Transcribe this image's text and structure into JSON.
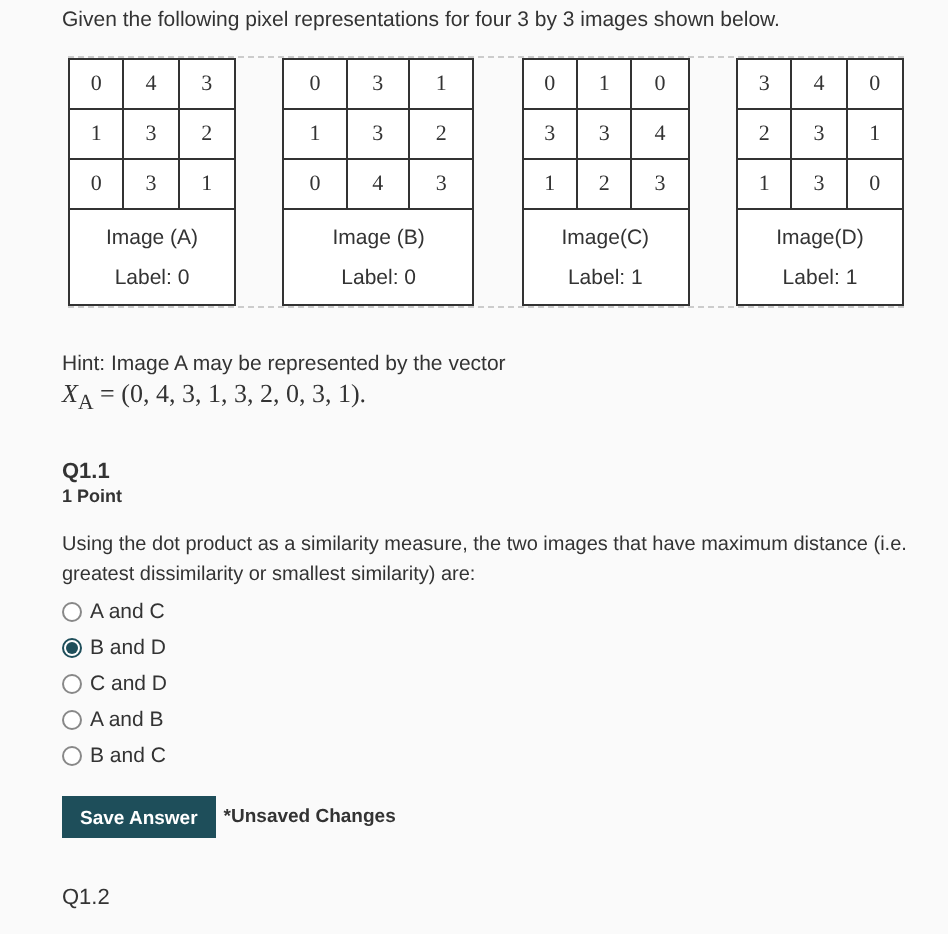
{
  "intro": "Given the following pixel representations for four 3 by 3 images shown below.",
  "images": [
    {
      "rows": [
        [
          "0",
          "4",
          "3"
        ],
        [
          "1",
          "3",
          "2"
        ],
        [
          "0",
          "3",
          "1"
        ]
      ],
      "name": "Image (A)",
      "label": "Label: 0"
    },
    {
      "rows": [
        [
          "0",
          "3",
          "1"
        ],
        [
          "1",
          "3",
          "2"
        ],
        [
          "0",
          "4",
          "3"
        ]
      ],
      "name": "Image (B)",
      "label": "Label: 0"
    },
    {
      "rows": [
        [
          "0",
          "1",
          "0"
        ],
        [
          "3",
          "3",
          "4"
        ],
        [
          "1",
          "2",
          "3"
        ]
      ],
      "name": "Image(C)",
      "label": "Label: 1"
    },
    {
      "rows": [
        [
          "3",
          "4",
          "0"
        ],
        [
          "2",
          "3",
          "1"
        ],
        [
          "1",
          "3",
          "0"
        ]
      ],
      "name": "Image(D)",
      "label": "Label: 1"
    }
  ],
  "hint": "Hint: Image A may be represented by the vector",
  "formula": "*X*$_{A}$ = (0, 4, 3, 1, 3, 2, 0, 3, 1).",
  "question": {
    "number": "Q1.1",
    "points": "1 Point",
    "text": "Using the dot product as a similarity measure, the two images that have maximum distance (i.e. greatest dissimilarity or smallest similarity) are:",
    "options": [
      {
        "label": "A and C",
        "selected": false
      },
      {
        "label": "B and D",
        "selected": true
      },
      {
        "label": "C and D",
        "selected": false
      },
      {
        "label": "A and B",
        "selected": false
      },
      {
        "label": "B and C",
        "selected": false
      }
    ],
    "button": "Save Answer",
    "status": "*Unsaved Changes"
  },
  "next_question": "Q1.2"
}
